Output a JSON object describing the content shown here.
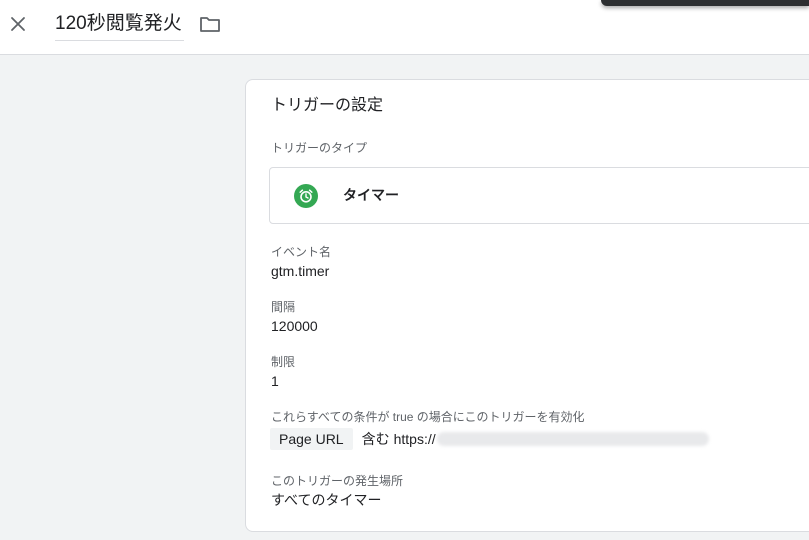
{
  "header": {
    "title": "120秒閲覧発火",
    "close_icon": "close-icon",
    "folder_icon": "folder-icon"
  },
  "card": {
    "title": "トリガーの設定",
    "trigger_type": {
      "label": "トリガーのタイプ",
      "name": "タイマー",
      "icon": "alarm-clock-icon",
      "icon_color": "#34a853"
    },
    "event_name": {
      "label": "イベント名",
      "value": "gtm.timer"
    },
    "interval": {
      "label": "間隔",
      "value": "120000"
    },
    "limit": {
      "label": "制限",
      "value": "1"
    },
    "conditions": {
      "label": "これらすべての条件が true の場合にこのトリガーを有効化",
      "variable": "Page URL",
      "operator": "含む",
      "value_prefix": "https://"
    },
    "fires_on": {
      "label": "このトリガーの発生場所",
      "value": "すべてのタイマー"
    }
  }
}
